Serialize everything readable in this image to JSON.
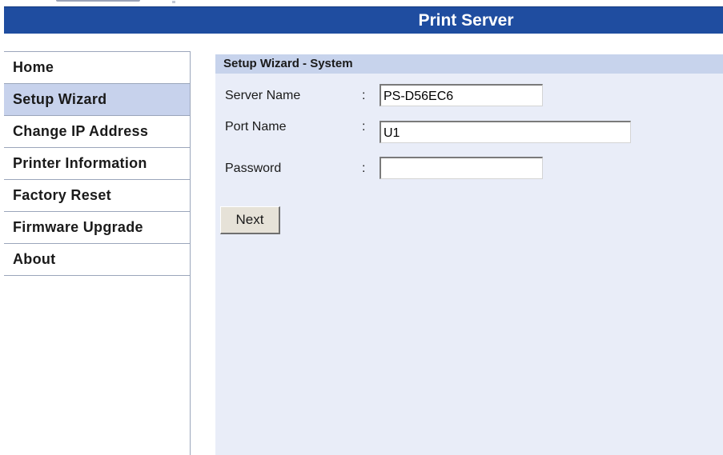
{
  "header": {
    "title": "Print Server"
  },
  "sidebar": {
    "items": [
      {
        "label": "Home",
        "active": false
      },
      {
        "label": "Setup Wizard",
        "active": true
      },
      {
        "label": "Change IP Address",
        "active": false
      },
      {
        "label": "Printer Information",
        "active": false
      },
      {
        "label": "Factory Reset",
        "active": false
      },
      {
        "label": "Firmware Upgrade",
        "active": false
      },
      {
        "label": "About",
        "active": false
      }
    ]
  },
  "main": {
    "section_title": "Setup Wizard - System",
    "fields": [
      {
        "label": "Server Name",
        "separator": ":",
        "value": ""
      },
      {
        "label": "Port Name",
        "separator": ":",
        "value": ""
      },
      {
        "label": "Password",
        "separator": ":",
        "value": ""
      }
    ],
    "field_values": {
      "server_name": "PS-D56EC6",
      "port_name": "U1",
      "password": ""
    },
    "next_label": "Next"
  },
  "colors": {
    "header_bg": "#1f4da0",
    "header_text": "#ffffff",
    "active_nav_bg": "#c7d2ec",
    "content_bg": "#e9edf8",
    "section_header_bg": "#c7d3ec"
  }
}
